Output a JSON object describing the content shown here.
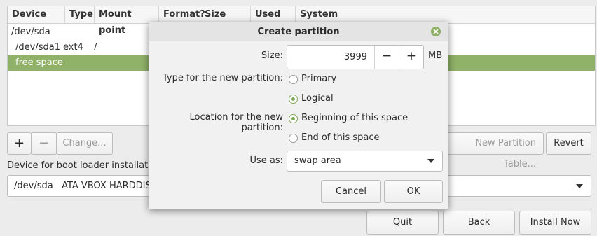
{
  "partition_table": {
    "columns": [
      "Device",
      "Type",
      "Mount point",
      "Format?",
      "Size",
      "Used",
      "System"
    ],
    "rows": [
      {
        "device": "/dev/sda",
        "type": "",
        "mount": ""
      },
      {
        "device": "/dev/sda1",
        "type": "ext4",
        "mount": "/"
      },
      {
        "device": "free space",
        "type": "",
        "mount": ""
      }
    ]
  },
  "toolbar": {
    "add_label": "+",
    "remove_label": "−",
    "change_label": "Change...",
    "new_table_label": "New Partition Table...",
    "revert_label": "Revert"
  },
  "bootloader": {
    "label": "Device for boot loader installation:",
    "selected": "/dev/sda   ATA VBOX HARDDISK"
  },
  "footer": {
    "quit_label": "Quit",
    "back_label": "Back",
    "install_label": "Install Now"
  },
  "dialog": {
    "title": "Create partition",
    "size_label": "Size:",
    "size_value": "3999",
    "size_decrement": "−",
    "size_increment": "+",
    "size_unit": "MB",
    "type_label": "Type for the new partition:",
    "type_options": [
      "Primary",
      "Logical"
    ],
    "type_selected": "Logical",
    "location_label": "Location for the new partition:",
    "location_options": [
      "Beginning of this space",
      "End of this space"
    ],
    "location_selected": "Beginning of this space",
    "use_as_label": "Use as:",
    "use_as_value": "swap area",
    "cancel_label": "Cancel",
    "ok_label": "OK"
  },
  "colors": {
    "accent": "#8fb168",
    "background": "#ececec"
  }
}
